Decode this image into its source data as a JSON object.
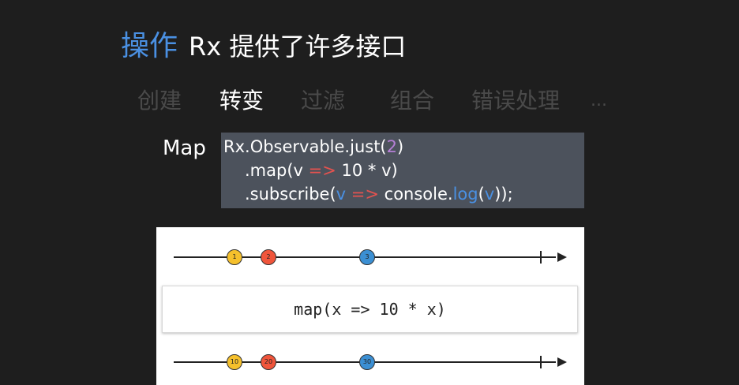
{
  "slide": {
    "title_keyword": "操作",
    "title_rest": "Rx 提供了许多接口",
    "tabs": [
      {
        "label": "创建",
        "active": false
      },
      {
        "label": "转变",
        "active": true
      },
      {
        "label": "过滤",
        "active": false
      },
      {
        "label": "组合",
        "active": false
      },
      {
        "label": "错误处理",
        "active": false
      },
      {
        "label": "...",
        "active": false
      }
    ],
    "example_label": "Map",
    "code": {
      "line1_a": "Rx.Observable.just(",
      "line1_num": "2",
      "line1_b": ")",
      "line2_a": ".map(v ",
      "line2_op": "=>",
      "line2_b": " 10 * v)",
      "line3_a": ".subscribe(",
      "line3_v1": "v",
      "line3_op": " =>",
      "line3_b": " console.",
      "line3_log": "log",
      "line3_c": "(",
      "line3_v2": "v",
      "line3_d": "));"
    },
    "diagram": {
      "operator_text": "map(x => 10 * x)",
      "input_marbles": [
        {
          "label": "1",
          "color": "#f5c02c"
        },
        {
          "label": "2",
          "color": "#f0553b"
        },
        {
          "label": "3",
          "color": "#3b8fd3"
        }
      ],
      "output_marbles": [
        {
          "label": "10",
          "color": "#f5c02c"
        },
        {
          "label": "20",
          "color": "#f0553b"
        },
        {
          "label": "30",
          "color": "#3b8fd3"
        }
      ]
    }
  }
}
